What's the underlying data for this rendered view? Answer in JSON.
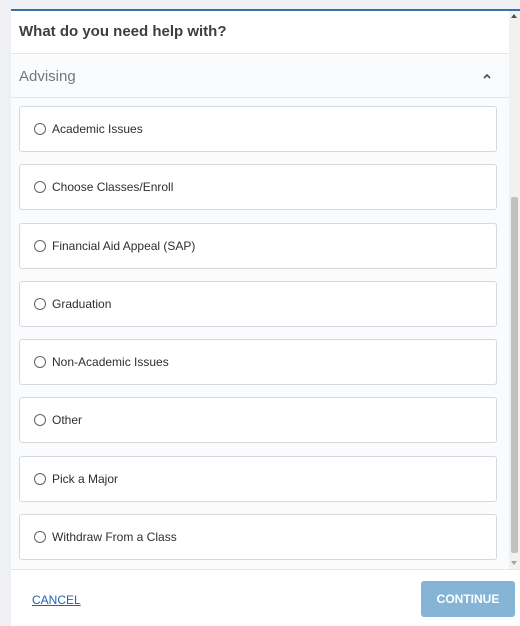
{
  "dialog": {
    "title": "What do you need help with?"
  },
  "section": {
    "title": "Advising",
    "expanded": true,
    "options": [
      {
        "label": "Academic Issues"
      },
      {
        "label": "Choose Classes/Enroll"
      },
      {
        "label": "Financial Aid Appeal (SAP)"
      },
      {
        "label": "Graduation"
      },
      {
        "label": "Non-Academic Issues"
      },
      {
        "label": "Other"
      },
      {
        "label": "Pick a Major"
      },
      {
        "label": "Withdraw From a Class"
      }
    ]
  },
  "footer": {
    "cancel_label": "CANCEL",
    "continue_label": "CONTINUE",
    "continue_enabled": false
  },
  "colors": {
    "accent_border": "#3b6fa6",
    "link": "#1f63b5",
    "continue_disabled": "#86b4d6"
  },
  "icons": {
    "section_toggle": "chevron-up-icon",
    "option_selector": "radio-unchecked-icon"
  }
}
